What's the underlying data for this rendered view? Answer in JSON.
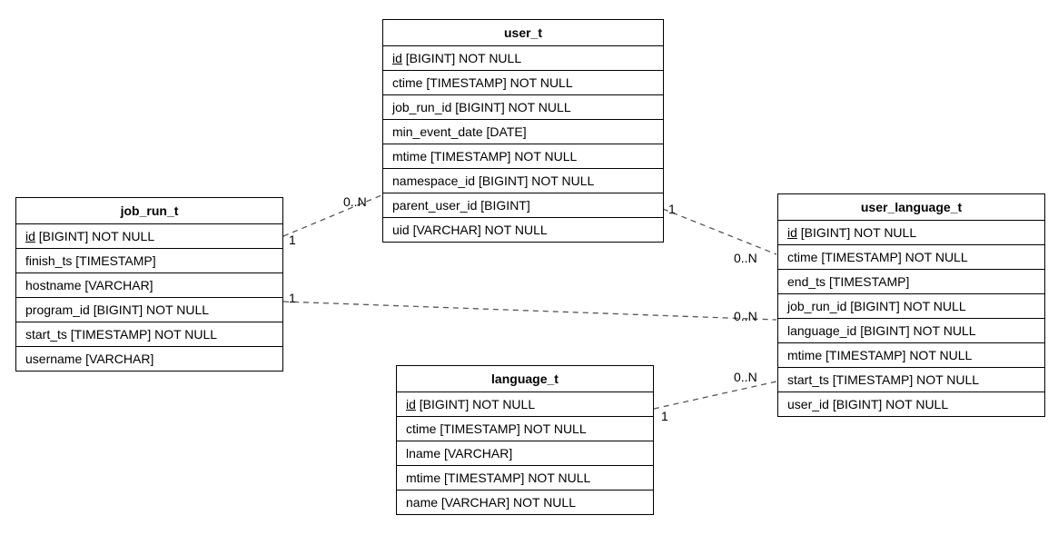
{
  "entities": {
    "job_run_t": {
      "title": "job_run_t",
      "attrs": [
        {
          "name": "id",
          "type": "[BIGINT] NOT NULL",
          "pk": true
        },
        {
          "name": "finish_ts",
          "type": "[TIMESTAMP]",
          "pk": false
        },
        {
          "name": "hostname",
          "type": "[VARCHAR]",
          "pk": false
        },
        {
          "name": "program_id",
          "type": "[BIGINT] NOT NULL",
          "pk": false
        },
        {
          "name": "start_ts",
          "type": "[TIMESTAMP] NOT NULL",
          "pk": false
        },
        {
          "name": "username",
          "type": "[VARCHAR]",
          "pk": false
        }
      ]
    },
    "user_t": {
      "title": "user_t",
      "attrs": [
        {
          "name": "id",
          "type": "[BIGINT] NOT NULL",
          "pk": true
        },
        {
          "name": "ctime",
          "type": "[TIMESTAMP] NOT NULL",
          "pk": false
        },
        {
          "name": "job_run_id",
          "type": "[BIGINT] NOT NULL",
          "pk": false
        },
        {
          "name": "min_event_date",
          "type": "[DATE]",
          "pk": false
        },
        {
          "name": "mtime",
          "type": "[TIMESTAMP] NOT NULL",
          "pk": false
        },
        {
          "name": "namespace_id",
          "type": "[BIGINT] NOT NULL",
          "pk": false
        },
        {
          "name": "parent_user_id",
          "type": "[BIGINT]",
          "pk": false
        },
        {
          "name": "uid",
          "type": "[VARCHAR] NOT NULL",
          "pk": false
        }
      ]
    },
    "language_t": {
      "title": "language_t",
      "attrs": [
        {
          "name": "id",
          "type": "[BIGINT] NOT NULL",
          "pk": true
        },
        {
          "name": "ctime",
          "type": "[TIMESTAMP] NOT NULL",
          "pk": false
        },
        {
          "name": "lname",
          "type": "[VARCHAR]",
          "pk": false
        },
        {
          "name": "mtime",
          "type": "[TIMESTAMP] NOT NULL",
          "pk": false
        },
        {
          "name": "name",
          "type": "[VARCHAR] NOT NULL",
          "pk": false
        }
      ]
    },
    "user_language_t": {
      "title": "user_language_t",
      "attrs": [
        {
          "name": "id",
          "type": "[BIGINT] NOT NULL",
          "pk": true
        },
        {
          "name": "ctime",
          "type": "[TIMESTAMP] NOT NULL",
          "pk": false
        },
        {
          "name": "end_ts",
          "type": "[TIMESTAMP]",
          "pk": false
        },
        {
          "name": "job_run_id",
          "type": "[BIGINT] NOT NULL",
          "pk": false
        },
        {
          "name": "language_id",
          "type": "[BIGINT] NOT NULL",
          "pk": false
        },
        {
          "name": "mtime",
          "type": "[TIMESTAMP] NOT NULL",
          "pk": false
        },
        {
          "name": "start_ts",
          "type": "[TIMESTAMP] NOT NULL",
          "pk": false
        },
        {
          "name": "user_id",
          "type": "[BIGINT] NOT NULL",
          "pk": false
        }
      ]
    }
  },
  "relationships": [
    {
      "from": "job_run_t",
      "to": "user_t",
      "from_card": "1",
      "to_card": "0..N"
    },
    {
      "from": "user_t",
      "to": "user_language_t",
      "from_card": "1",
      "to_card": "0..N"
    },
    {
      "from": "job_run_t",
      "to": "user_language_t",
      "from_card": "1",
      "to_card": "0..N"
    },
    {
      "from": "language_t",
      "to": "user_language_t",
      "from_card": "1",
      "to_card": "0..N"
    }
  ],
  "cards": {
    "c1a": "1",
    "c1b": "0..N",
    "c2a": "1",
    "c2b": "0..N",
    "c3a": "1",
    "c3b": "0..N",
    "c4a": "1",
    "c4b": "0..N"
  }
}
